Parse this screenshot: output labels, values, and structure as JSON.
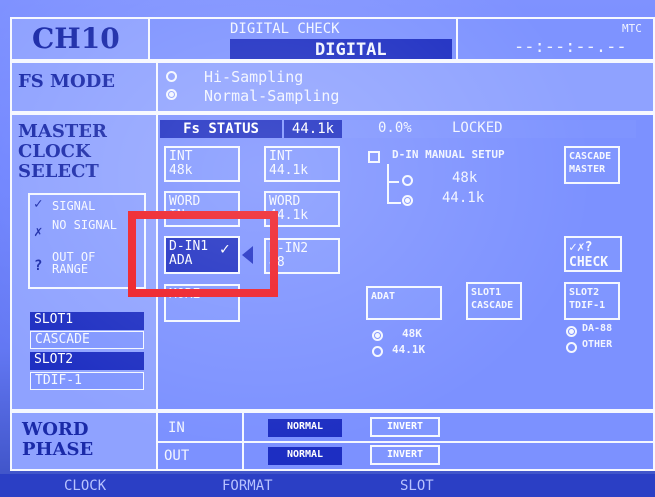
{
  "header": {
    "channel": "CH10",
    "mode_tags": "DIGITAL CHECK",
    "mode_title": "DIGITAL",
    "timecode": "--:--:--.--",
    "mtc_label": "MTC"
  },
  "fs_mode": {
    "label": "FS MODE",
    "options": [
      "Hi-Sampling",
      "Normal-Sampling"
    ],
    "selected": 1
  },
  "master_clock": {
    "label_lines": [
      "MASTER",
      "CLOCK",
      "SELECT"
    ],
    "legend": {
      "signal": "SIGNAL",
      "no_signal": "NO SIGNAL",
      "out_of_range": "OUT OF RANGE"
    },
    "slots": [
      {
        "label": "SLOT1",
        "selected": true
      },
      {
        "label": "CASCADE",
        "selected": false
      },
      {
        "label": "SLOT2",
        "selected": true
      },
      {
        "label": "TDIF-1",
        "selected": false
      }
    ]
  },
  "fs_status": {
    "label": "Fs STATUS",
    "rate": "44.1k",
    "offset": "0.0%",
    "lock": "LOCKED"
  },
  "clock_sources": {
    "int48": [
      "INT",
      "48k"
    ],
    "int441": [
      "INT",
      "44.1k"
    ],
    "word1": [
      "WORD",
      "IN"
    ],
    "word2": [
      "WORD",
      "44.1k"
    ],
    "din1": [
      "D-IN1",
      "ADA"
    ],
    "din2": [
      "D-IN2",
      "48"
    ],
    "other": "MORE"
  },
  "din_manual": {
    "label": "D-IN MANUAL SETUP",
    "options": [
      "48k",
      "44.1k"
    ],
    "selected": 1
  },
  "cascade_master": [
    "CASCADE",
    "MASTER"
  ],
  "check_button": {
    "icon": "✓✗?",
    "label": "CHECK"
  },
  "adat": {
    "label": "ADAT",
    "options": [
      "48K",
      "44.1K"
    ],
    "selected": 0
  },
  "slot1_cascade": [
    "SLOT1",
    "CASCADE"
  ],
  "slot2_tdif": {
    "label": [
      "SLOT2",
      "TDIF-1"
    ],
    "options": [
      "DA-88",
      "OTHER"
    ],
    "selected": 0
  },
  "word_phase": {
    "label_lines": [
      "WORD",
      "PHASE"
    ],
    "in_label": "IN",
    "out_label": "OUT",
    "in_mode": "NORMAL",
    "out_mode": "NORMAL",
    "in_button": "INVERT",
    "out_button": "INVERT"
  },
  "footer_tabs": [
    "CLOCK",
    "FORMAT",
    "SLOT"
  ],
  "colors": {
    "highlight": "#ee1b24",
    "panel_dark": "#1d2ec2"
  }
}
